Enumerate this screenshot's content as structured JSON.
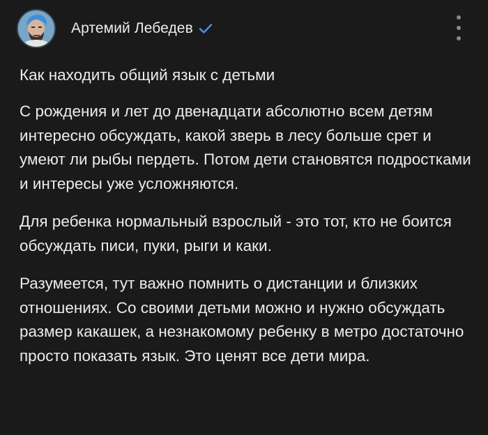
{
  "post": {
    "author": {
      "name": "Артемий Лебедев",
      "verified": true,
      "avatar_icon": "avatar-portrait"
    },
    "menu_icon": "more-vertical-icon",
    "title": "Как находить общий язык с детьми",
    "paragraphs": [
      "С рождения и лет до двенадцати абсолютно всем детям интересно обсуждать, какой зверь в лесу больше срет и умеют ли рыбы пердеть. Потом дети становятся подростками и интересы уже усложняются.",
      "Для ребенка нормальный взрослый - это тот, кто не боится обсуждать писи, пуки, рыги и каки.",
      "Разумеется, тут важно помнить о дистанции и близких отношениях. Со своими детьми можно и нужно обсуждать размер какашек, а незнакомому ребенку в метро достаточно просто показать язык. Это ценят все дети мира."
    ]
  },
  "colors": {
    "background": "#1a1a1a",
    "text": "#ececec",
    "verified_badge": "#4a8fd8",
    "menu_dots": "#8a8a8a"
  }
}
